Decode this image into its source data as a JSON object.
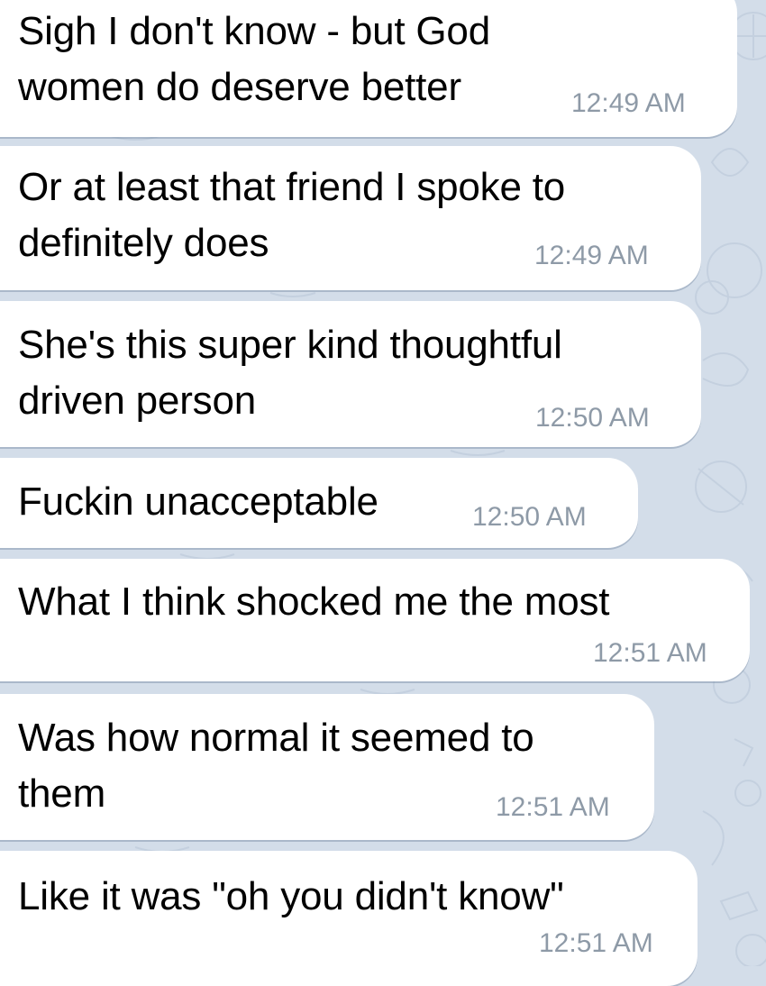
{
  "chat": {
    "messages": [
      {
        "text": "Sigh I don't know - but God\nwomen do deserve better",
        "time": "12:49 AM"
      },
      {
        "text": "Or at least that friend I spoke to\ndefinitely does",
        "time": "12:49 AM"
      },
      {
        "text": "She's this super kind thoughtful\ndriven person",
        "time": "12:50 AM"
      },
      {
        "text": "Fuckin unacceptable",
        "time": "12:50 AM"
      },
      {
        "text": "What I think shocked me the most",
        "time": "12:51 AM"
      },
      {
        "text": "Was how normal it seemed to\nthem",
        "time": "12:51 AM"
      },
      {
        "text": "Like it was \"oh you didn't know\"",
        "time": "12:51 AM"
      }
    ]
  },
  "colors": {
    "background": "#d3dde9",
    "bubble": "#ffffff",
    "text": "#000000",
    "timestamp": "#8e9aa7"
  }
}
